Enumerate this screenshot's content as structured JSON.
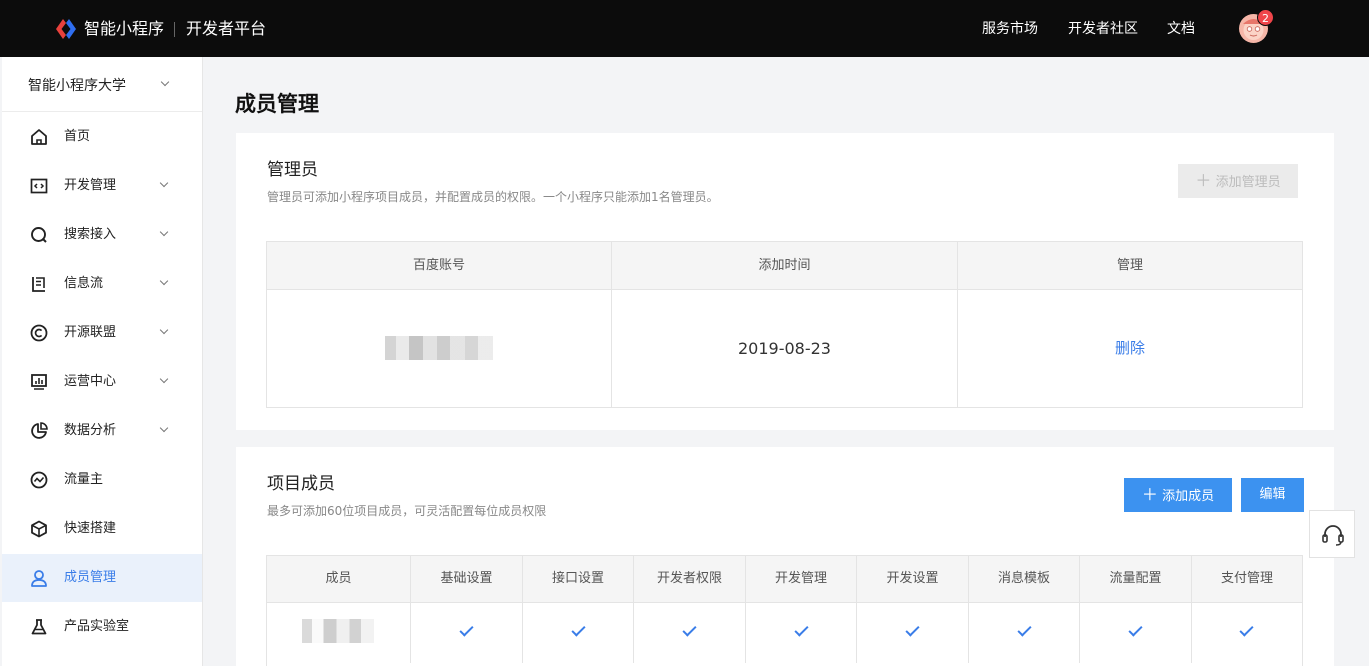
{
  "header": {
    "brand": "智能小程序",
    "platform": "开发者平台",
    "nav": [
      "服务市场",
      "开发者社区",
      "文档"
    ],
    "notification_count": "2"
  },
  "sidebar": {
    "app_name": "智能小程序大学",
    "items": [
      {
        "label": "首页",
        "icon": "home-icon",
        "has_chevron": false
      },
      {
        "label": "开发管理",
        "icon": "code-icon",
        "has_chevron": true
      },
      {
        "label": "搜索接入",
        "icon": "search-icon",
        "has_chevron": true
      },
      {
        "label": "信息流",
        "icon": "feed-icon",
        "has_chevron": true
      },
      {
        "label": "开源联盟",
        "icon": "copyright-icon",
        "has_chevron": true
      },
      {
        "label": "运营中心",
        "icon": "monitor-icon",
        "has_chevron": true
      },
      {
        "label": "数据分析",
        "icon": "pie-chart-icon",
        "has_chevron": true
      },
      {
        "label": "流量主",
        "icon": "trend-icon",
        "has_chevron": false
      },
      {
        "label": "快速搭建",
        "icon": "cube-icon",
        "has_chevron": false
      },
      {
        "label": "成员管理",
        "icon": "user-icon",
        "has_chevron": false,
        "active": true
      },
      {
        "label": "产品实验室",
        "icon": "flask-icon",
        "has_chevron": false
      }
    ]
  },
  "page": {
    "title": "成员管理"
  },
  "admin": {
    "title": "管理员",
    "desc": "管理员可添加小程序项目成员，并配置成员的权限。一个小程序只能添加1名管理员。",
    "add_button": "添加管理员",
    "columns": [
      "百度账号",
      "添加时间",
      "管理"
    ],
    "row": {
      "added": "2019-08-23",
      "action": "删除"
    }
  },
  "members": {
    "title": "项目成员",
    "desc": "最多可添加60位项目成员，可灵活配置每位成员权限",
    "add_button": "添加成员",
    "edit_button": "编辑",
    "columns": [
      "成员",
      "基础设置",
      "接口设置",
      "开发者权限",
      "开发管理",
      "开发设置",
      "消息模板",
      "流量配置",
      "支付管理"
    ],
    "row_permissions": [
      true,
      true,
      true,
      true,
      true,
      true,
      true,
      true
    ]
  },
  "colors": {
    "accent": "#3a7de8",
    "primary_button": "#3c92f0",
    "topbar": "#0c0c0c",
    "badge": "#f0454a"
  }
}
